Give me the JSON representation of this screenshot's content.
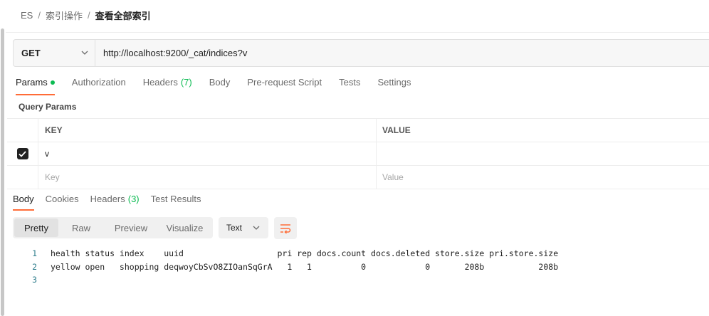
{
  "breadcrumb": {
    "items": [
      "ES",
      "索引操作"
    ],
    "current": "查看全部索引",
    "separator": "/"
  },
  "request": {
    "method": "GET",
    "url": "http://localhost:9200/_cat/indices?v"
  },
  "request_tabs": [
    {
      "label": "Params",
      "active": true,
      "indicator": "green-dot"
    },
    {
      "label": "Authorization"
    },
    {
      "label": "Headers",
      "count": "(7)"
    },
    {
      "label": "Body"
    },
    {
      "label": "Pre-request Script"
    },
    {
      "label": "Tests"
    },
    {
      "label": "Settings"
    }
  ],
  "query_params": {
    "title": "Query Params",
    "columns": {
      "key": "KEY",
      "value": "VALUE"
    },
    "rows": [
      {
        "checked": true,
        "key": "v",
        "value": ""
      }
    ],
    "placeholder": {
      "key": "Key",
      "value": "Value"
    }
  },
  "response_tabs": [
    {
      "label": "Body",
      "active": true
    },
    {
      "label": "Cookies"
    },
    {
      "label": "Headers",
      "count": "(3)"
    },
    {
      "label": "Test Results"
    }
  ],
  "view_modes": [
    {
      "label": "Pretty",
      "active": true
    },
    {
      "label": "Raw"
    },
    {
      "label": "Preview"
    },
    {
      "label": "Visualize"
    }
  ],
  "format": {
    "selected": "Text"
  },
  "icons": {
    "dropdown": "chevron-down-icon",
    "wrap": "wrap-lines-icon",
    "checkbox": "check-icon"
  },
  "colors": {
    "accent": "#ff6c37",
    "success": "#0cbb52"
  },
  "response_body": {
    "lines": [
      {
        "n": "1",
        "text": "health status index    uuid                   pri rep docs.count docs.deleted store.size pri.store.size"
      },
      {
        "n": "2",
        "text": "yellow open   shopping deqwoyCbSvO8ZIOanSqGrA   1   1          0            0       208b           208b"
      },
      {
        "n": "3",
        "text": ""
      }
    ]
  }
}
